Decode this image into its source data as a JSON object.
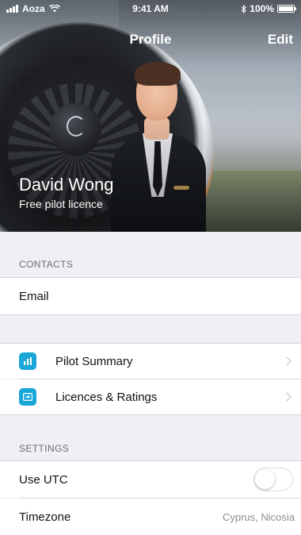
{
  "status_bar": {
    "carrier": "Aoza",
    "time": "9:41 AM",
    "battery": "100%"
  },
  "nav": {
    "title": "Profile",
    "edit_label": "Edit"
  },
  "profile": {
    "name": "David Wong",
    "subtitle": "Free pilot licence"
  },
  "sections": {
    "contacts_header": "CONTACTS",
    "email_label": "Email",
    "pilot_summary_label": "Pilot Summary",
    "licences_label": "Licences & Ratings",
    "settings_header": "SETTINGS",
    "use_utc_label": "Use UTC",
    "use_utc_on": false,
    "timezone_label": "Timezone",
    "timezone_value": "Cyprus, Nicosia"
  },
  "icons": {
    "pilot_summary": "bar-chart-icon",
    "licences": "licence-card-icon",
    "accent_color": "#19a6d8"
  }
}
